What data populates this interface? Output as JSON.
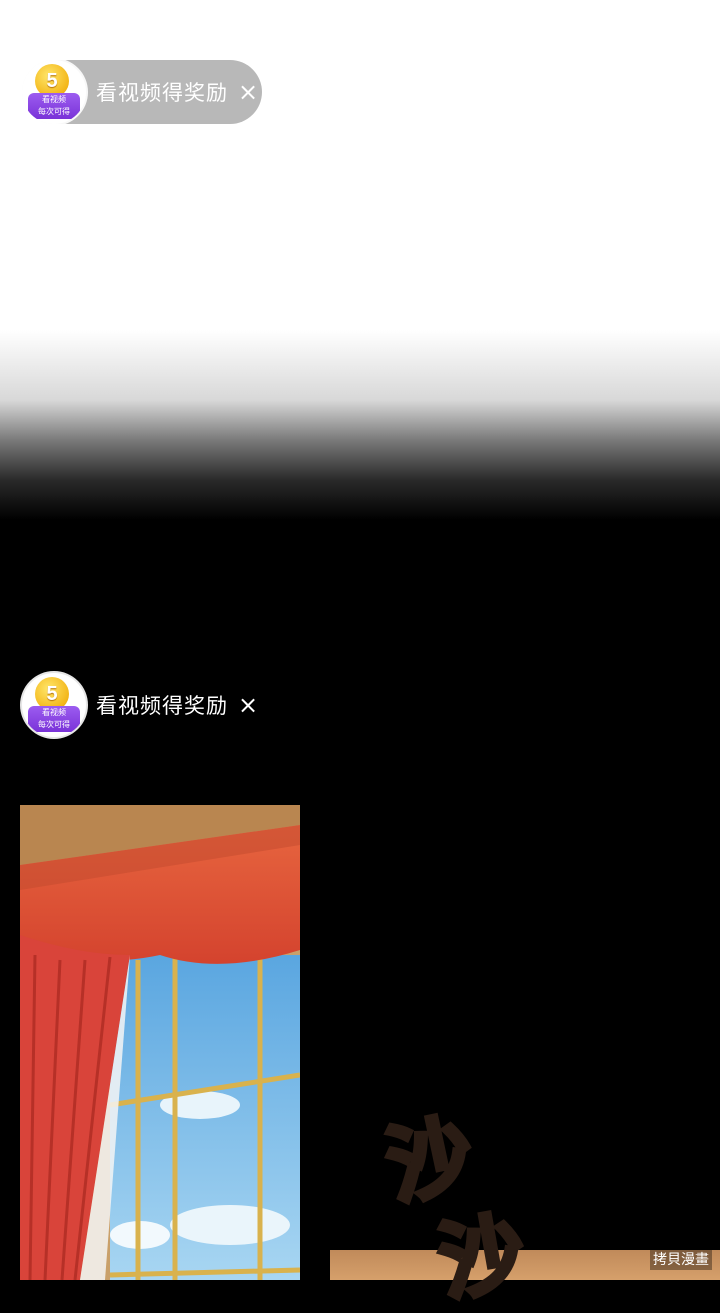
{
  "reward_banner": {
    "coin_value": "5",
    "badge_line1": "看视频",
    "badge_line2": "每次可得",
    "label": "看视频得奖励",
    "close_symbol": "×"
  },
  "sound_effect": {
    "glyph1": "沙",
    "glyph2": "沙"
  },
  "watermark": "拷貝漫畫",
  "colors": {
    "pill_bg": "#a0a0a0",
    "badge_purple": "#8a46e4",
    "coin_gold": "#f3b619",
    "curtain_red": "#d9503a",
    "sky_blue": "#6fb3e6"
  }
}
